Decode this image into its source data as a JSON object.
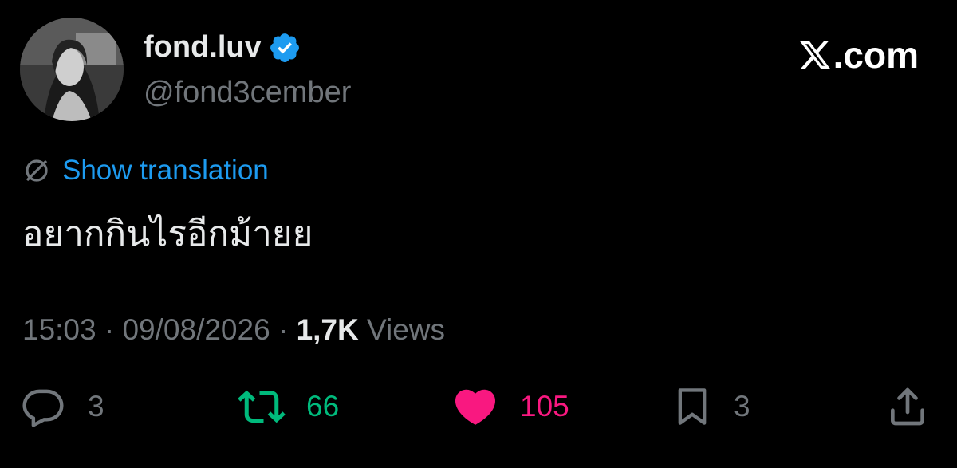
{
  "author": {
    "display_name": "fond.luv",
    "handle": "@fond3cember",
    "verified": true,
    "avatar": "profile-photo"
  },
  "brand": {
    "logo_icon": "x-logo-icon",
    "label": ".com"
  },
  "translation": {
    "label": "Show translation",
    "icon": "globe-icon"
  },
  "tweet": {
    "text": "อยากกินไรอีกม้ายย"
  },
  "meta": {
    "time": "15:03",
    "separator": " · ",
    "date": "09/08/2026",
    "views_count": "1,7K",
    "views_label": " Views"
  },
  "actions": {
    "reply": {
      "icon": "reply-icon",
      "count": "3"
    },
    "retweet": {
      "icon": "retweet-icon",
      "count": "66"
    },
    "like": {
      "icon": "heart-icon",
      "count": "105"
    },
    "bookmark": {
      "icon": "bookmark-icon",
      "count": "3"
    },
    "share": {
      "icon": "share-icon"
    }
  },
  "colors": {
    "background": "#000000",
    "primary_text": "#e7e9ea",
    "secondary_text": "#71767b",
    "link_blue": "#1d9bf0",
    "verified_blue": "#1d9bf0",
    "retweet_green": "#00ba7c",
    "like_pink": "#f91880"
  }
}
